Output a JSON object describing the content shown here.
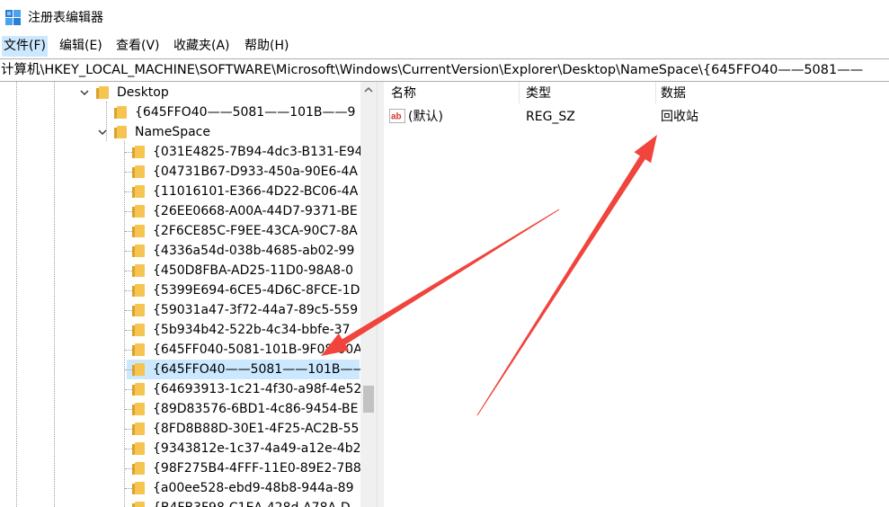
{
  "window": {
    "title": "注册表编辑器"
  },
  "menu": [
    {
      "label": "文件(F)"
    },
    {
      "label": "编辑(E)"
    },
    {
      "label": "查看(V)"
    },
    {
      "label": "收藏夹(A)"
    },
    {
      "label": "帮助(H)"
    }
  ],
  "address": {
    "path": "计算机\\HKEY_LOCAL_MACHINE\\SOFTWARE\\Microsoft\\Windows\\CurrentVersion\\Explorer\\Desktop\\NameSpace\\{645FFO40——5081——"
  },
  "tree": {
    "desktop": "Desktop",
    "desktop_child": "{645FFO40——5081——101B——9",
    "namespace": "NameSpace",
    "keys": [
      "{031E4825-7B94-4dc3-B131-E94",
      "{04731B67-D933-450a-90E6-4A",
      "{11016101-E366-4D22-BC06-4A",
      "{26EE0668-A00A-44D7-9371-BE",
      "{2F6CE85C-F9EE-43CA-90C7-8A",
      "{4336a54d-038b-4685-ab02-99",
      "{450D8FBA-AD25-11D0-98A8-0",
      "{5399E694-6CE5-4D6C-8FCE-1D",
      "{59031a47-3f72-44a7-89c5-559",
      "{5b934b42-522b-4c34-bbfe-37",
      "{645FF040-5081-101B-9F08-00A",
      "{645FFO40——5081——101B——",
      "{64693913-1c21-4f30-a98f-4e52",
      "{89D83576-6BD1-4c86-9454-BE",
      "{8FD8B88D-30E1-4F25-AC2B-55",
      "{9343812e-1c37-4a49-a12e-4b2",
      "{98F275B4-4FFF-11E0-89E2-7B8",
      "{a00ee528-ebd9-48b8-944a-89",
      "{B4FB3F98-C1EA-428d-A78A-D"
    ],
    "selected_index": 11
  },
  "list": {
    "headers": {
      "name": "名称",
      "type": "类型",
      "data": "数据"
    },
    "rows": [
      {
        "name": "(默认)",
        "type": "REG_SZ",
        "data": "回收站"
      }
    ]
  },
  "annotation_color": "#f0443c"
}
